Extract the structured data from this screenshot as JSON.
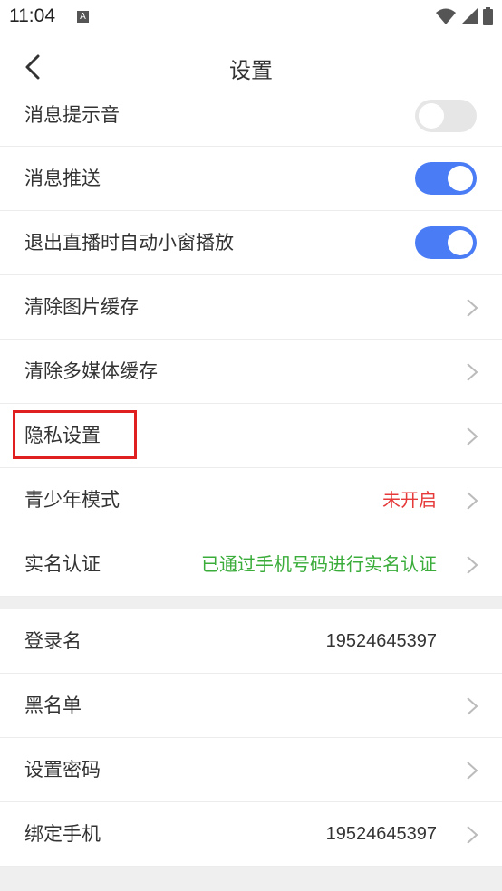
{
  "status_bar": {
    "time": "11:04",
    "notification_icon": "A"
  },
  "nav": {
    "title": "设置"
  },
  "settings": {
    "message_sound": {
      "label": "消息提示音",
      "enabled": false
    },
    "message_push": {
      "label": "消息推送",
      "enabled": true
    },
    "pip_on_exit": {
      "label": "退出直播时自动小窗播放",
      "enabled": true
    },
    "clear_image_cache": {
      "label": "清除图片缓存"
    },
    "clear_media_cache": {
      "label": "清除多媒体缓存"
    },
    "privacy": {
      "label": "隐私设置"
    },
    "teen_mode": {
      "label": "青少年模式",
      "value": "未开启"
    },
    "real_name": {
      "label": "实名认证",
      "value": "已通过手机号码进行实名认证"
    },
    "login_name": {
      "label": "登录名",
      "value": "19524645397"
    },
    "blacklist": {
      "label": "黑名单"
    },
    "set_password": {
      "label": "设置密码"
    },
    "bind_phone": {
      "label": "绑定手机",
      "value": "19524645397"
    }
  },
  "colors": {
    "toggle_on": "#4a7cf5",
    "warning": "#e63a3a",
    "success": "#3aac3a",
    "highlight": "#e02020"
  }
}
